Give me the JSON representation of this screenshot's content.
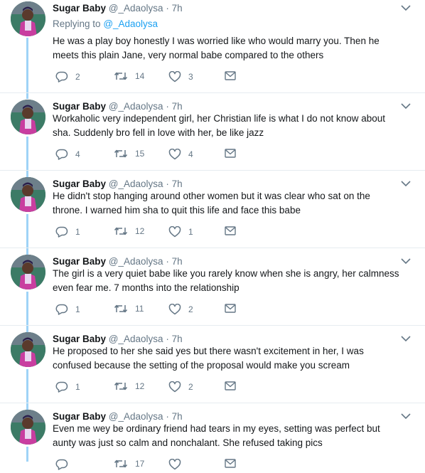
{
  "tweets": [
    {
      "name": "Sugar Baby",
      "handle": "@_Adaolysa",
      "dot": "·",
      "time": "7h",
      "replying_prefix": "Replying to",
      "replying_handle": "@_Adaolysa",
      "lines": [
        "He was a play boy honestly I was worried like who would marry you. Then he",
        "meets this plain Jane, very normal babe compared to the others"
      ],
      "replies": "2",
      "retweets": "14",
      "likes": "3"
    },
    {
      "name": "Sugar Baby",
      "handle": "@_Adaolysa",
      "dot": "·",
      "time": "7h",
      "lines": [
        "Workaholic very independent girl, her Christian life is what I do not know about",
        "sha. Suddenly bro fell in love with her, be like jazz"
      ],
      "replies": "4",
      "retweets": "15",
      "likes": "4"
    },
    {
      "name": "Sugar Baby",
      "handle": "@_Adaolysa",
      "dot": "·",
      "time": "7h",
      "lines": [
        "He didn't stop hanging around other women but it was clear who sat on the",
        "throne. I warned him sha to quit this life and face this babe"
      ],
      "replies": "1",
      "retweets": "12",
      "likes": "1"
    },
    {
      "name": "Sugar Baby",
      "handle": "@_Adaolysa",
      "dot": "·",
      "time": "7h",
      "lines": [
        "The girl is a very quiet babe like you rarely know when she is angry, her calmness",
        "even fear me. 7 months into the relationship"
      ],
      "replies": "1",
      "retweets": "11",
      "likes": "2"
    },
    {
      "name": "Sugar Baby",
      "handle": "@_Adaolysa",
      "dot": "·",
      "time": "7h",
      "lines": [
        "He proposed to her she said yes but there wasn't excitement in her, I was",
        "confused because the setting of the proposal would make you scream"
      ],
      "replies": "1",
      "retweets": "12",
      "likes": "2"
    },
    {
      "name": "Sugar Baby",
      "handle": "@_Adaolysa",
      "dot": "·",
      "time": "7h",
      "lines": [
        "Even me wey be ordinary friend had tears in my eyes, setting was perfect but",
        "aunty was just so calm and nonchalant. She refused taking pics"
      ],
      "replies": "",
      "retweets": "17",
      "likes": ""
    }
  ],
  "colors": {
    "accent": "#1da1f2",
    "thread": "#9fd3f7",
    "muted": "#657786"
  },
  "icons": [
    "avatar",
    "chevron-down-icon",
    "reply-icon",
    "retweet-icon",
    "like-icon",
    "dm-icon"
  ]
}
